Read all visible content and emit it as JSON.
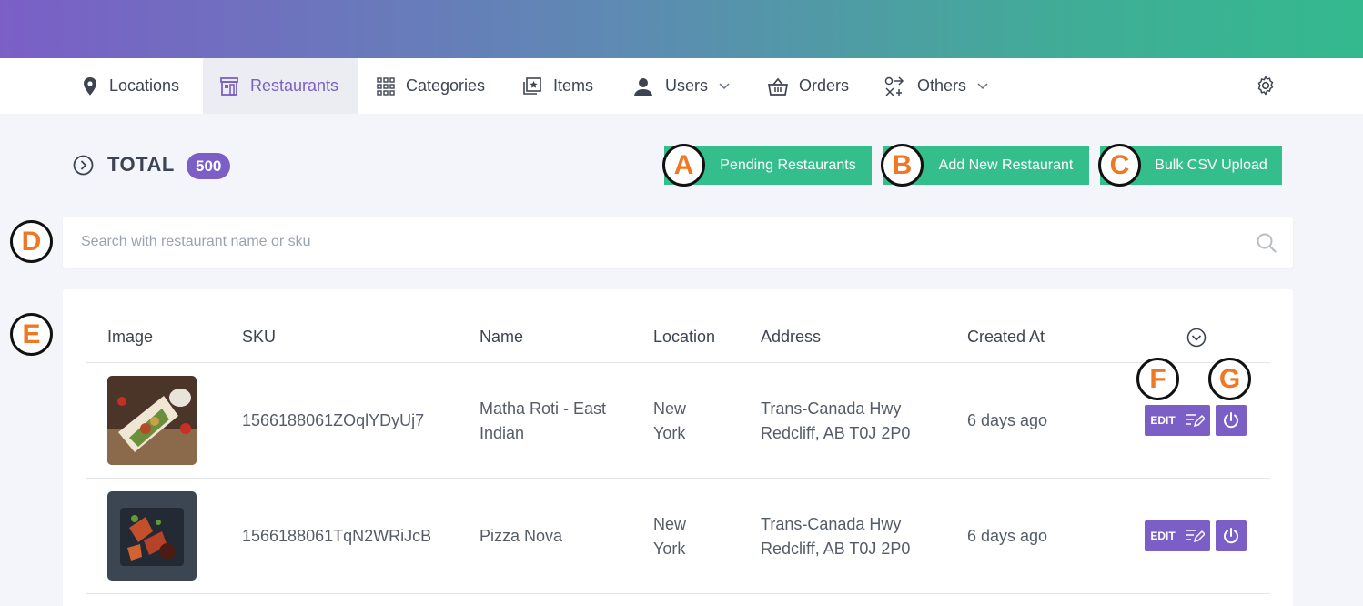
{
  "nav": {
    "items": [
      {
        "label": "Locations",
        "icon": "map-pin-icon"
      },
      {
        "label": "Restaurants",
        "icon": "store-icon",
        "active": true
      },
      {
        "label": "Categories",
        "icon": "grid-icon"
      },
      {
        "label": "Items",
        "icon": "photos-icon"
      },
      {
        "label": "Users",
        "icon": "user-icon",
        "dropdown": true
      },
      {
        "label": "Orders",
        "icon": "basket-icon"
      },
      {
        "label": "Others",
        "icon": "others-icon",
        "dropdown": true
      }
    ],
    "settings_icon": "gear-icon"
  },
  "summary": {
    "label": "TOTAL",
    "count": "500"
  },
  "actions": {
    "pending": "Pending Restaurants",
    "add_new": "Add New Restaurant",
    "bulk_csv": "Bulk CSV Upload"
  },
  "markers": {
    "a": "A",
    "b": "B",
    "c": "C",
    "d": "D",
    "e": "E",
    "f": "F",
    "g": "G"
  },
  "search": {
    "placeholder": "Search with restaurant name or sku",
    "value": ""
  },
  "table": {
    "columns": [
      "Image",
      "SKU",
      "Name",
      "Location",
      "Address",
      "Created At"
    ],
    "rows": [
      {
        "sku": "1566188061ZOqlYDyUj7",
        "name_line1": "Matha Roti - East",
        "name_line2": "Indian",
        "location_line1": "New",
        "location_line2": "York",
        "address_line1": "Trans-Canada Hwy",
        "address_line2": "Redcliff, AB T0J 2P0",
        "created": "6 days ago",
        "edit_label": "EDIT"
      },
      {
        "sku": "1566188061TqN2WRiJcB",
        "name_line1": "Pizza Nova",
        "name_line2": "",
        "location_line1": "New",
        "location_line2": "York",
        "address_line1": "Trans-Canada Hwy",
        "address_line2": "Redcliff, AB T0J 2P0",
        "created": "6 days ago",
        "edit_label": "EDIT"
      }
    ]
  },
  "colors": {
    "primary": "#7b5fc7",
    "success": "#34be8c",
    "marker_text": "#f07822"
  }
}
